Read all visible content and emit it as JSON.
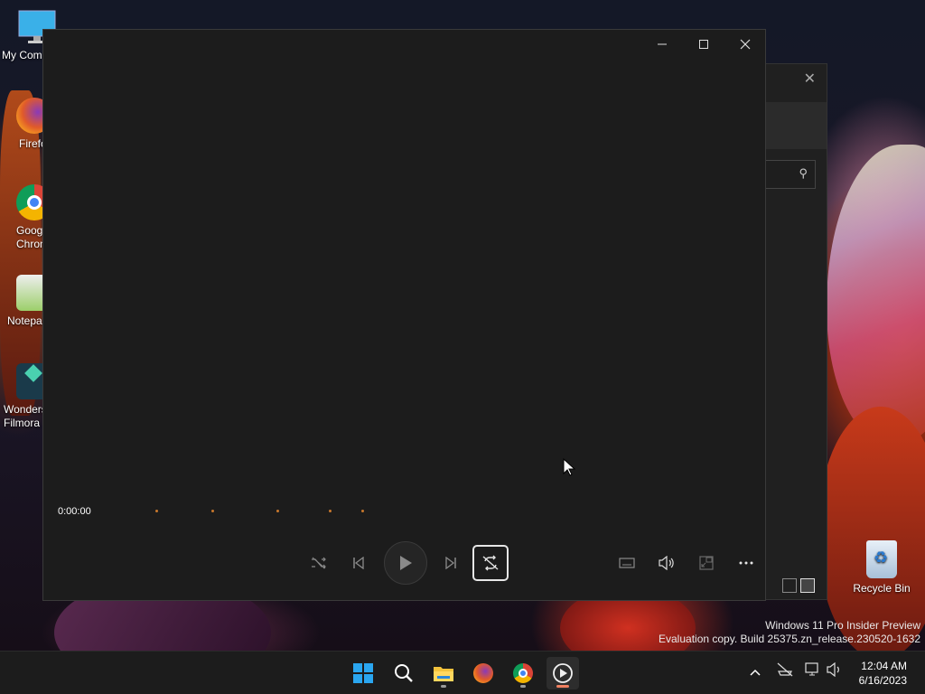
{
  "desktop": {
    "icons": [
      {
        "label": "My Com",
        "icon": "monitor-icon"
      },
      {
        "label": "Firefo",
        "icon": "firefox-icon"
      },
      {
        "label": "Goog\nChron",
        "icon": "chrome-icon"
      },
      {
        "label": "Notepa",
        "icon": "notepad-icon"
      },
      {
        "label": "Wonders\nFilmora",
        "icon": "filmora-icon"
      }
    ],
    "recycle_bin": "Recycle Bin"
  },
  "player": {
    "title_buttons": {
      "minimize": "minimize-icon",
      "maximize": "maximize-icon",
      "close": "close-icon"
    },
    "current_time": "0:00:00",
    "controls": [
      "shuffle-icon",
      "previous-icon",
      "play-icon",
      "next-icon",
      "repeat-off-icon",
      "captions-icon",
      "volume-icon",
      "miniplayer-icon",
      "more-icon"
    ],
    "accent_color": "#c8782c"
  },
  "watermark": {
    "line1": "Windows 11 Pro Insider Preview",
    "line2": "Evaluation copy. Build 25375.zn_release.230520-1632"
  },
  "taskbar": {
    "apps": [
      "start-icon",
      "search-icon",
      "file-explorer-icon",
      "firefox-icon",
      "chrome-icon",
      "media-player-icon"
    ],
    "tray": [
      "chevron-up-icon",
      "network-icon",
      "display-icon",
      "volume-icon"
    ],
    "time": "12:04 AM",
    "date": "6/16/2023"
  }
}
